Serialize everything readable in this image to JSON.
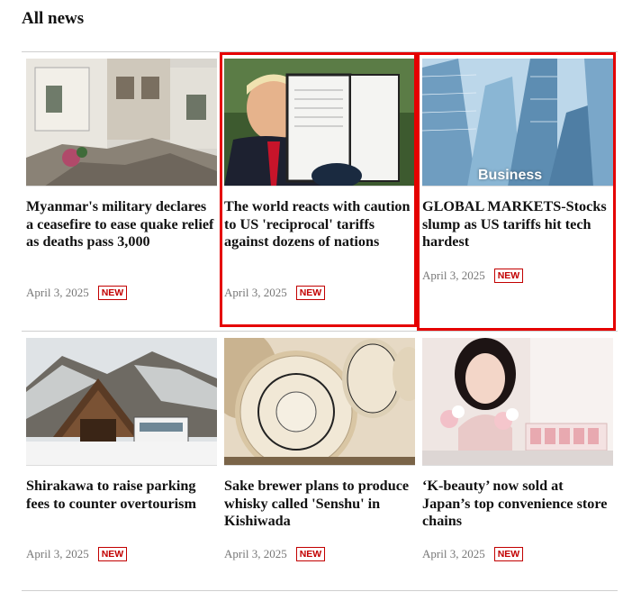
{
  "section": {
    "title": "All news"
  },
  "articles": [
    {
      "headline": "Myanmar's military declares a ceasefire to ease quake relief as deaths pass 3,000",
      "date": "April 3, 2025",
      "badge": "NEW"
    },
    {
      "headline": "The world reacts with caution to US 'reciprocal' tariffs against dozens of nations",
      "date": "April 3, 2025",
      "badge": "NEW"
    },
    {
      "headline": "GLOBAL MARKETS-Stocks slump as US tariffs hit tech hardest",
      "date": "April 3, 2025",
      "badge": "NEW",
      "image_label": "Business"
    },
    {
      "headline": "Shirakawa to raise parking fees to counter overtourism",
      "date": "April 3, 2025",
      "badge": "NEW"
    },
    {
      "headline": "Sake brewer plans to produce whisky called 'Senshu' in Kishiwada",
      "date": "April 3, 2025",
      "badge": "NEW"
    },
    {
      "headline": "‘K-beauty’ now sold at Japan’s top convenience store chains",
      "date": "April 3, 2025",
      "badge": "NEW"
    }
  ],
  "colors": {
    "badge": "#c20000",
    "highlight": "#e50000",
    "rule": "#cfcfcf"
  }
}
